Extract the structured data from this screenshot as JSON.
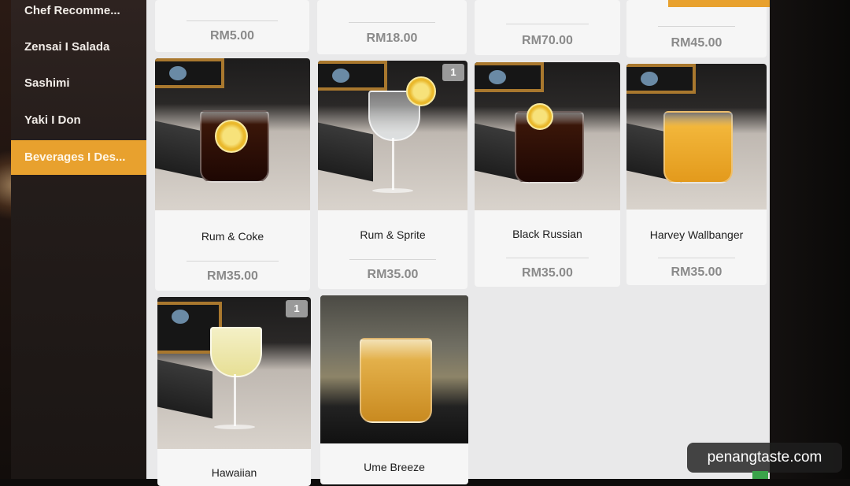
{
  "sidebar": {
    "categories": [
      {
        "label": "Chef Recomme..."
      },
      {
        "label": "Zensai I Salada"
      },
      {
        "label": "Sashimi"
      },
      {
        "label": "Yaki I Don"
      },
      {
        "label": "Beverages I Des..."
      }
    ],
    "active_index": 4
  },
  "top_row": [
    {
      "price": "RM5.00"
    },
    {
      "price": "RM18.00"
    },
    {
      "price": "RM70.00"
    },
    {
      "price": "RM45.00"
    }
  ],
  "items": [
    {
      "name": "Rum & Coke",
      "price": "RM35.00",
      "badge": ""
    },
    {
      "name": "Rum & Sprite",
      "price": "RM35.00",
      "badge": "1"
    },
    {
      "name": "Black Russian",
      "price": "RM35.00",
      "badge": ""
    },
    {
      "name": "Harvey Wallbanger",
      "price": "RM35.00",
      "badge": ""
    },
    {
      "name": "Hawaiian",
      "price": "",
      "badge": "1"
    },
    {
      "name": "Ume Breeze",
      "price": "",
      "badge": ""
    }
  ],
  "watermark": "penangtaste.com",
  "colors": {
    "accent": "#e8a12e",
    "sidebar_bg": "#231c1a",
    "card_bg": "#f6f6f6",
    "price_text": "#8a8a8a"
  }
}
